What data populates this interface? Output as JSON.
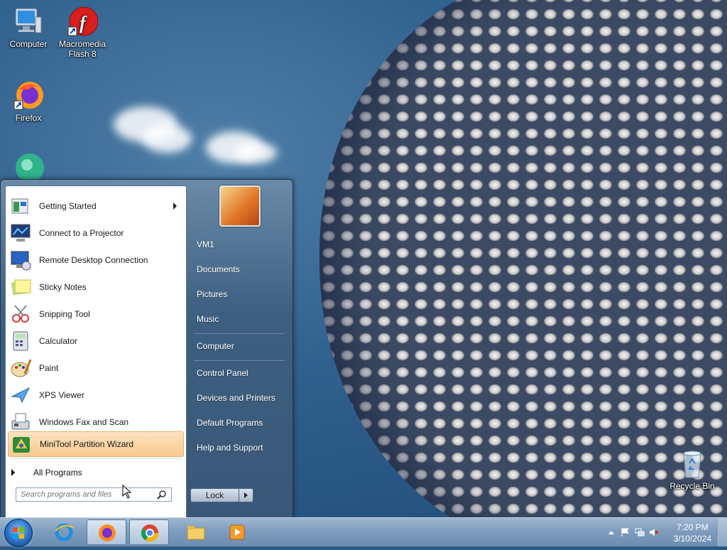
{
  "desktop": {
    "icons": [
      {
        "label": "Computer"
      },
      {
        "label": "Macromedia Flash 8"
      },
      {
        "label": "Firefox"
      },
      {
        "label": "Recycle Bin"
      }
    ]
  },
  "start_menu": {
    "programs": [
      {
        "label": "Getting Started",
        "has_submenu": true
      },
      {
        "label": "Connect to a Projector"
      },
      {
        "label": "Remote Desktop Connection"
      },
      {
        "label": "Sticky Notes"
      },
      {
        "label": "Snipping Tool"
      },
      {
        "label": "Calculator"
      },
      {
        "label": "Paint"
      },
      {
        "label": "XPS Viewer"
      },
      {
        "label": "Windows Fax and Scan"
      },
      {
        "label": "MiniTool Partition Wizard",
        "selected": true
      }
    ],
    "all_programs_label": "All Programs",
    "search_placeholder": "Search programs and files",
    "right_items": [
      {
        "label": "VM1"
      },
      {
        "label": "Documents"
      },
      {
        "label": "Pictures"
      },
      {
        "label": "Music"
      },
      {
        "label": "Computer"
      },
      {
        "label": "Control Panel"
      },
      {
        "label": "Devices and Printers"
      },
      {
        "label": "Default Programs"
      },
      {
        "label": "Help and Support"
      }
    ],
    "lock_label": "Lock"
  },
  "taskbar": {
    "pinned": [
      {
        "icon": "internet-explorer-icon"
      },
      {
        "icon": "firefox-icon",
        "active": true
      },
      {
        "icon": "chrome-icon",
        "active": true
      },
      {
        "icon": "file-explorer-icon"
      },
      {
        "icon": "media-player-icon"
      }
    ],
    "clock": {
      "time": "7:20 PM",
      "date": "3/10/2024"
    }
  },
  "colors": {
    "selected_item": "#f8c98e",
    "taskbar": "#7e9dbd",
    "start_menu_right": "#3d5f80"
  }
}
